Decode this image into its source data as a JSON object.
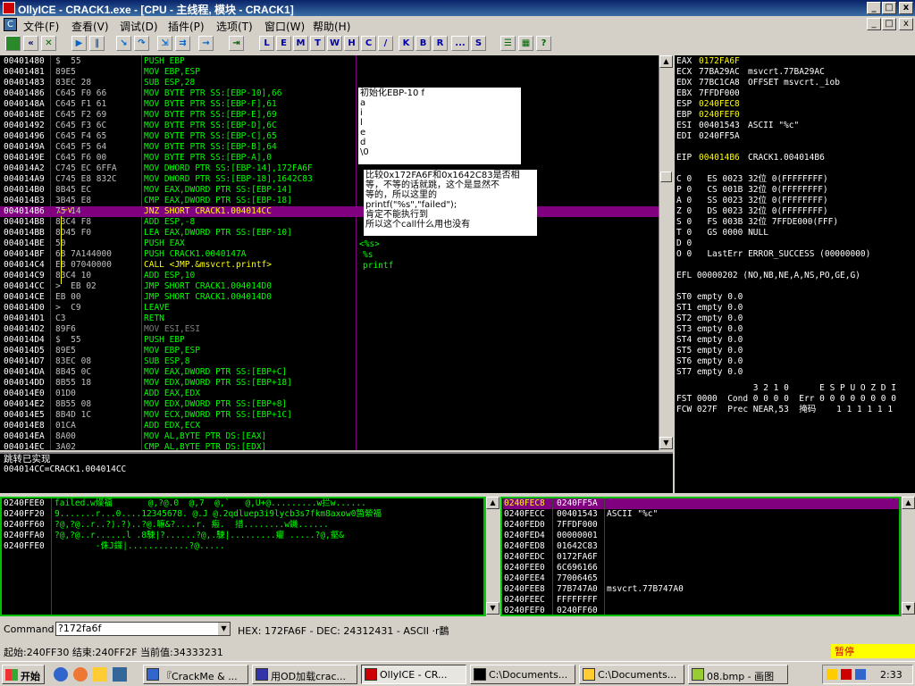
{
  "window": {
    "title": "OllyICE - CRACK1.exe - [CPU -  主线程, 模块 - CRACK1]",
    "buttons": [
      "_",
      "□",
      "x"
    ]
  },
  "menu": [
    "文件(F)",
    "查看(V)",
    "调试(D)",
    "插件(P)",
    "选项(T)",
    "窗口(W)",
    "帮助(H)"
  ],
  "toolbar": {
    "letters": [
      "L",
      "E",
      "M",
      "T",
      "W",
      "H",
      "C",
      "/",
      "K",
      "B",
      "R",
      "...",
      "S"
    ]
  },
  "disasm": [
    [
      "00401480",
      "$  55",
      "PUSH EBP"
    ],
    [
      "00401481",
      "89E5",
      "MOV EBP,ESP"
    ],
    [
      "00401483",
      "83EC 28",
      "SUB ESP,28"
    ],
    [
      "00401486",
      "C645 F0 66",
      "MOV BYTE PTR SS:[EBP-10],66"
    ],
    [
      "0040148A",
      "C645 F1 61",
      "MOV BYTE PTR SS:[EBP-F],61"
    ],
    [
      "0040148E",
      "C645 F2 69",
      "MOV BYTE PTR SS:[EBP-E],69"
    ],
    [
      "00401492",
      "C645 F3 6C",
      "MOV BYTE PTR SS:[EBP-D],6C"
    ],
    [
      "00401496",
      "C645 F4 65",
      "MOV BYTE PTR SS:[EBP-C],65"
    ],
    [
      "0040149A",
      "C645 F5 64",
      "MOV BYTE PTR SS:[EBP-B],64"
    ],
    [
      "0040149E",
      "C645 F6 00",
      "MOV BYTE PTR SS:[EBP-A],0"
    ],
    [
      "004014A2",
      "C745 EC 6FFA",
      "MOV DWORD PTR SS:[EBP-14],172FA6F"
    ],
    [
      "004014A9",
      "C745 E8 832C",
      "MOV DWORD PTR SS:[EBP-18],1642C83"
    ],
    [
      "004014B0",
      "8B45 EC",
      "MOV EAX,DWORD PTR SS:[EBP-14]"
    ],
    [
      "004014B3",
      "3B45 E8",
      "CMP EAX,DWORD PTR SS:[EBP-18]"
    ],
    [
      "004014B6",
      "75 14",
      "JNZ SHORT CRACK1.004014CC"
    ],
    [
      "004014B8",
      "83C4 F8",
      "ADD ESP,-8"
    ],
    [
      "004014BB",
      "8D45 F0",
      "LEA EAX,DWORD PTR SS:[EBP-10]"
    ],
    [
      "004014BE",
      "50",
      "PUSH EAX"
    ],
    [
      "004014BF",
      "68 7A144000",
      "PUSH CRACK1.0040147A"
    ],
    [
      "004014C4",
      "E8 07040000",
      "CALL <JMP.&msvcrt.printf>"
    ],
    [
      "004014C9",
      "83C4 10",
      "ADD ESP,10"
    ],
    [
      "004014CC",
      ">  EB 02",
      "JMP SHORT CRACK1.004014D0"
    ],
    [
      "004014CE",
      "EB 00",
      "JMP SHORT CRACK1.004014D0"
    ],
    [
      "004014D0",
      ">  C9",
      "LEAVE"
    ],
    [
      "004014D1",
      "C3",
      "RETN"
    ],
    [
      "004014D2",
      "89F6",
      "MOV ESI,ESI"
    ],
    [
      "004014D4",
      "$  55",
      "PUSH EBP"
    ],
    [
      "004014D5",
      "89E5",
      "MOV EBP,ESP"
    ],
    [
      "004014D7",
      "83EC 08",
      "SUB ESP,8"
    ],
    [
      "004014DA",
      "8B45 0C",
      "MOV EAX,DWORD PTR SS:[EBP+C]"
    ],
    [
      "004014DD",
      "8B55 18",
      "MOV EDX,DWORD PTR SS:[EBP+18]"
    ],
    [
      "004014E0",
      "01D0",
      "ADD EAX,EDX"
    ],
    [
      "004014E2",
      "8B55 08",
      "MOV EDX,DWORD PTR SS:[EBP+8]"
    ],
    [
      "004014E5",
      "8B4D 1C",
      "MOV ECX,DWORD PTR SS:[EBP+1C]"
    ],
    [
      "004014E8",
      "01CA",
      "ADD EDX,ECX"
    ],
    [
      "004014EA",
      "8A00",
      "MOV AL,BYTE PTR DS:[EAX]"
    ],
    [
      "004014EC",
      "3A02",
      "CMP AL,BYTE PTR DS:[EDX]"
    ]
  ],
  "comments": {
    "r1": "<%s>",
    "r2": "%s",
    "r3": "printf"
  },
  "note1": [
    "初始化EBP-10 f",
    "a",
    "i",
    "l",
    "e",
    "d",
    "\\0"
  ],
  "note2": [
    "比较0x172FA6F和0x1642C83是否相",
    "等，不等的话就跳，这个是显然不",
    "等的，所以这里的",
    "printf(\"%s\",\"failed\");",
    "肯定不能执行到",
    "所以这个call什么用也没有"
  ],
  "info": [
    "跳转已实现",
    "004014CC=CRACK1.004014CC"
  ],
  "registers": [
    [
      "EAX",
      "0172FA6F",
      ""
    ],
    [
      "ECX",
      "77BA29AC",
      "msvcrt.77BA29AC"
    ],
    [
      "EDX",
      "77BC1CA8",
      "OFFSET msvcrt._iob"
    ],
    [
      "EBX",
      "7FFDF000",
      ""
    ],
    [
      "ESP",
      "0240FEC8",
      ""
    ],
    [
      "EBP",
      "0240FEF0",
      ""
    ],
    [
      "ESI",
      "00401543",
      "ASCII \"%c\""
    ],
    [
      "EDI",
      "0240FF5A",
      ""
    ],
    [
      "EIP",
      "004014B6",
      "CRACK1.004014B6"
    ]
  ],
  "flags": [
    "C 0   ES 0023 32位 0(FFFFFFFF)",
    "P 0   CS 001B 32位 0(FFFFFFFF)",
    "A 0   SS 0023 32位 0(FFFFFFFF)",
    "Z 0   DS 0023 32位 0(FFFFFFFF)",
    "S 0   FS 003B 32位 7FFDE000(FFF)",
    "T 0   GS 0000 NULL",
    "D 0",
    "O 0   LastErr ERROR_SUCCESS (00000000)"
  ],
  "efl": "EFL 00000202 (NO,NB,NE,A,NS,PO,GE,G)",
  "fpu": [
    "ST0 empty 0.0",
    "ST1 empty 0.0",
    "ST2 empty 0.0",
    "ST3 empty 0.0",
    "ST4 empty 0.0",
    "ST5 empty 0.0",
    "ST6 empty 0.0",
    "ST7 empty 0.0"
  ],
  "fpuctl": [
    "               3 2 1 0      E S P U O Z D I",
    "FST 0000  Cond 0 0 0 0  Err 0 0 0 0 0 0 0 0",
    "FCW 027F  Prec NEAR,53  掩码    1 1 1 1 1 1"
  ],
  "dump": [
    [
      "0240FEE0",
      "failed.w燥福       @,?@.0  @,7  @,`   @,U+@.........w拦w......"
    ],
    [
      "0240FF20",
      "9.......r...0....12345678. @.J @.2qdluep3i9lycb3s7fkm8axow0箇縈福"
    ],
    [
      "0240FF60",
      "?@,?@..r..?).?)..?@.嘛&?....r. 瘢.  措........w鐖......"
    ],
    [
      "0240FFA0",
      "?@,?@..r......l .8駷|?......?@,.駷|.........癯 .....?@,壑&"
    ],
    [
      "0240FFE0",
      "        -侏J鏼|............?@....."
    ]
  ],
  "stack": [
    [
      "0240FEC8",
      "0240FF5A",
      ""
    ],
    [
      "0240FECC",
      "00401543",
      "ASCII \"%c\""
    ],
    [
      "0240FED0",
      "7FFDF000",
      ""
    ],
    [
      "0240FED4",
      "00000001",
      ""
    ],
    [
      "0240FED8",
      "01642C83",
      ""
    ],
    [
      "0240FEDC",
      "0172FA6F",
      ""
    ],
    [
      "0240FEE0",
      "6C696166",
      ""
    ],
    [
      "0240FEE4",
      "77006465",
      ""
    ],
    [
      "0240FEE8",
      "77B747A0",
      "msvcrt.77B747A0"
    ],
    [
      "0240FEEC",
      "FFFFFFFF",
      ""
    ],
    [
      "0240FEF0",
      "0240FF60",
      ""
    ]
  ],
  "command": {
    "label": "Command :",
    "value": "?172fa6f",
    "result": "HEX: 172FA6F - DEC: 24312431 - ASCII  ·r鷭"
  },
  "status": {
    "text": "起始:240FF30 结束:240FF2F 当前值:34333231",
    "state": "暂停"
  },
  "taskbar": {
    "start": "开始",
    "tasks": [
      "『CrackMe & ...",
      "用OD加载crac...",
      "OllyICE - CR...",
      "C:\\Documents...",
      "C:\\Documents...",
      "08.bmp - 画图"
    ],
    "clock": "2:33"
  },
  "colors": {
    "green": "#00ff00",
    "yellow": "#ffff00",
    "selpurple": "#800080",
    "hexwhite": "#c0c0c0"
  }
}
